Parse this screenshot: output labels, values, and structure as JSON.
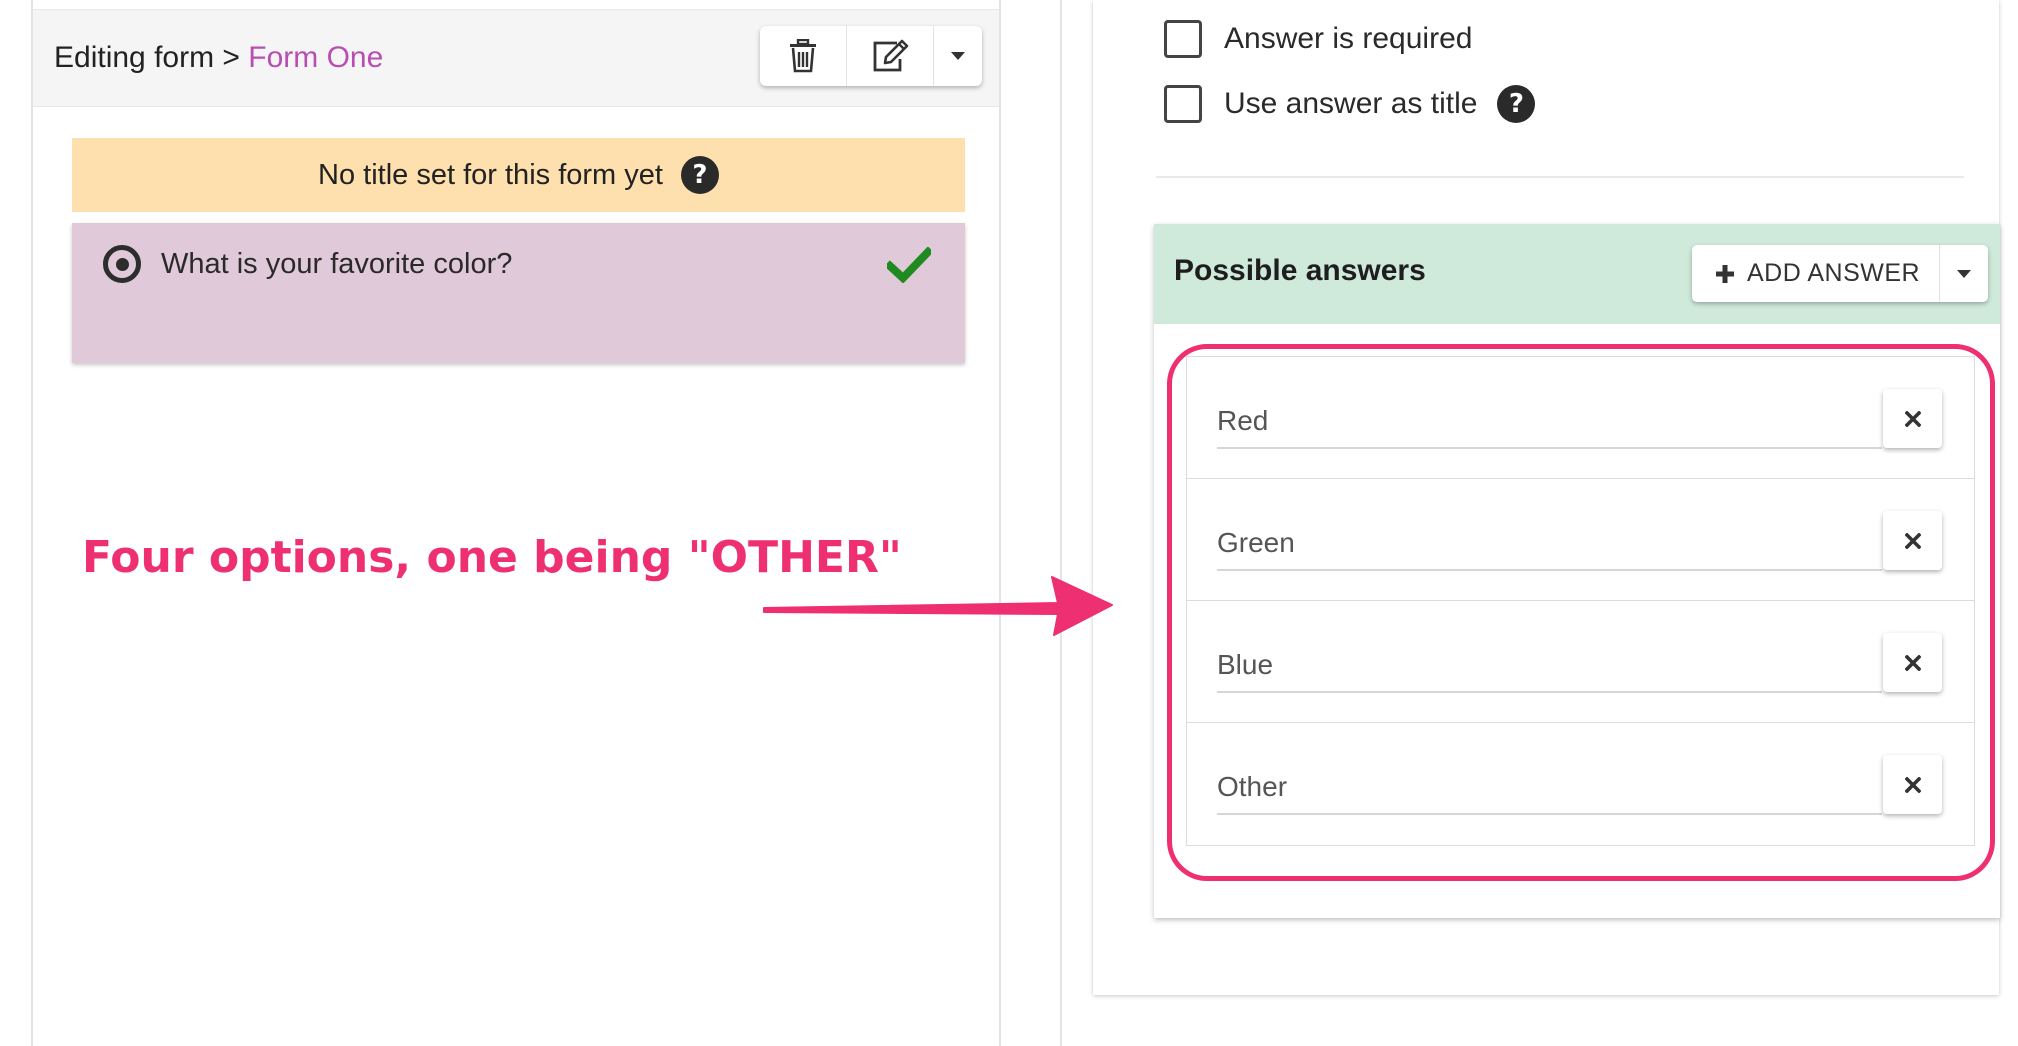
{
  "header": {
    "breadcrumb_prefix": "Editing form >",
    "form_name": "Form One",
    "buttons": {
      "delete_icon": "trash-icon",
      "edit_icon": "edit-icon",
      "menu_icon": "caret-down-icon"
    }
  },
  "notice": {
    "text": "No title set for this form yet",
    "help_glyph": "?"
  },
  "question": {
    "text": "What is your favorite color?",
    "type_icon": "radio-icon",
    "status_icon": "checkmark-icon"
  },
  "annotation": {
    "text": "Four options, one being \"OTHER\""
  },
  "settings": {
    "required_label": "Answer is required",
    "title_label": "Use answer as title",
    "help_glyph": "?"
  },
  "answers": {
    "title": "Possible answers",
    "add_label": "ADD ANSWER",
    "add_icon": "plus-icon",
    "items": [
      {
        "value": "Red"
      },
      {
        "value": "Green"
      },
      {
        "value": "Blue"
      },
      {
        "value": "Other"
      }
    ],
    "remove_icon": "close-icon"
  },
  "colors": {
    "accent_pink": "#ee2f72",
    "form_name": "#b84eb3",
    "notice_bg": "#fde0ad",
    "question_bg": "#e0c9d9",
    "answers_header_bg": "#cfe9da",
    "check_green": "#1f8a1f"
  }
}
